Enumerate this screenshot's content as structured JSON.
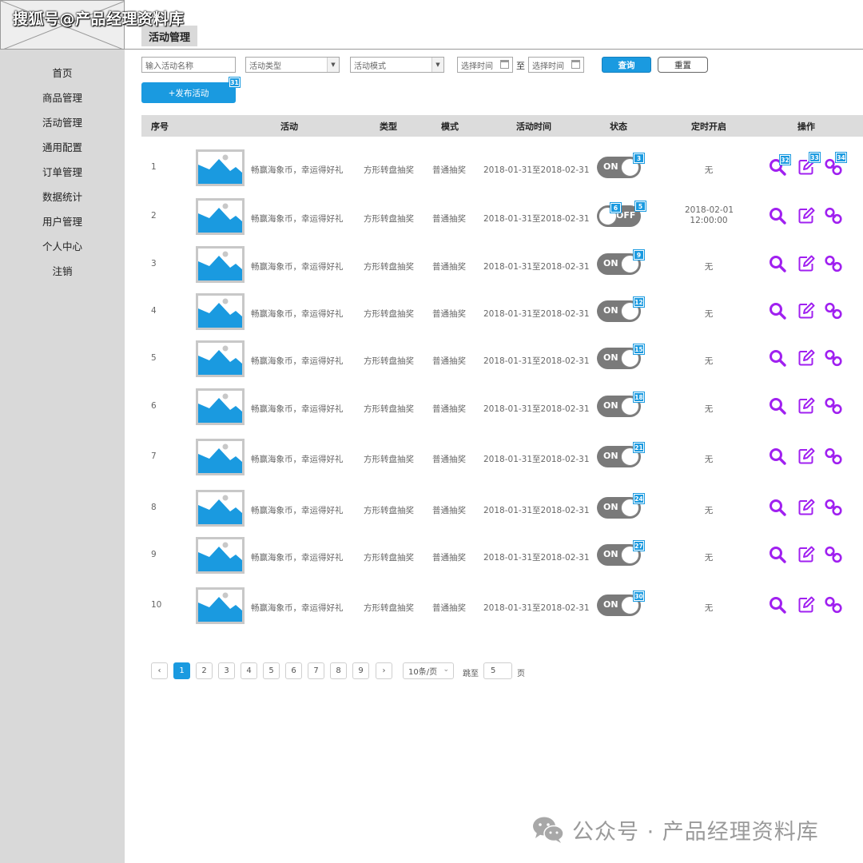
{
  "watermark_top": "搜狐号@产品经理资料库",
  "page_tab": "活动管理",
  "sidebar": {
    "items": [
      {
        "label": "首页"
      },
      {
        "label": "商品管理"
      },
      {
        "label": "活动管理"
      },
      {
        "label": "通用配置"
      },
      {
        "label": "订单管理"
      },
      {
        "label": "数据统计"
      },
      {
        "label": "用户管理"
      },
      {
        "label": "个人中心"
      },
      {
        "label": "注销"
      }
    ]
  },
  "filters": {
    "name_placeholder": "输入活动名称",
    "type_placeholder": "活动类型",
    "mode_placeholder": "活动模式",
    "start_placeholder": "选择时间",
    "to_label": "至",
    "end_placeholder": "选择时间",
    "query_label": "查询",
    "reset_label": "重置"
  },
  "publish": {
    "label": "+发布活动",
    "badge": "31"
  },
  "table": {
    "headers": [
      "序号",
      "活动",
      "类型",
      "模式",
      "活动时间",
      "状态",
      "定时开启",
      "操作"
    ],
    "op_badges": [
      "32",
      "33",
      "34"
    ],
    "rows": [
      {
        "idx": "1",
        "name": "畅赢海象币，幸运得好礼",
        "type": "方形转盘抽奖",
        "mode": "普通抽奖",
        "time": "2018-01-31至2018-02-31",
        "status": "ON",
        "badges": [
          "3"
        ],
        "timer": [
          "无"
        ]
      },
      {
        "idx": "2",
        "name": "畅赢海象币，幸运得好礼",
        "type": "方形转盘抽奖",
        "mode": "普通抽奖",
        "time": "2018-01-31至2018-02-31",
        "status": "OFF",
        "badges": [
          "6",
          "5"
        ],
        "timer": [
          "2018-02-01",
          "12:00:00"
        ]
      },
      {
        "idx": "3",
        "name": "畅赢海象币，幸运得好礼",
        "type": "方形转盘抽奖",
        "mode": "普通抽奖",
        "time": "2018-01-31至2018-02-31",
        "status": "ON",
        "badges": [
          "9"
        ],
        "timer": [
          "无"
        ]
      },
      {
        "idx": "4",
        "name": "畅赢海象币，幸运得好礼",
        "type": "方形转盘抽奖",
        "mode": "普通抽奖",
        "time": "2018-01-31至2018-02-31",
        "status": "ON",
        "badges": [
          "12"
        ],
        "timer": [
          "无"
        ]
      },
      {
        "idx": "5",
        "name": "畅赢海象币，幸运得好礼",
        "type": "方形转盘抽奖",
        "mode": "普通抽奖",
        "time": "2018-01-31至2018-02-31",
        "status": "ON",
        "badges": [
          "15"
        ],
        "timer": [
          "无"
        ]
      },
      {
        "idx": "6",
        "name": "畅赢海象币，幸运得好礼",
        "type": "方形转盘抽奖",
        "mode": "普通抽奖",
        "time": "2018-01-31至2018-02-31",
        "status": "ON",
        "badges": [
          "18"
        ],
        "timer": [
          "无"
        ]
      },
      {
        "idx": "7",
        "name": "畅赢海象币，幸运得好礼",
        "type": "方形转盘抽奖",
        "mode": "普通抽奖",
        "time": "2018-01-31至2018-02-31",
        "status": "ON",
        "badges": [
          "21"
        ],
        "timer": [
          "无"
        ]
      },
      {
        "idx": "8",
        "name": "畅赢海象币，幸运得好礼",
        "type": "方形转盘抽奖",
        "mode": "普通抽奖",
        "time": "2018-01-31至2018-02-31",
        "status": "ON",
        "badges": [
          "24"
        ],
        "timer": [
          "无"
        ]
      },
      {
        "idx": "9",
        "name": "畅赢海象币，幸运得好礼",
        "type": "方形转盘抽奖",
        "mode": "普通抽奖",
        "time": "2018-01-31至2018-02-31",
        "status": "ON",
        "badges": [
          "27"
        ],
        "timer": [
          "无"
        ]
      },
      {
        "idx": "10",
        "name": "畅赢海象币，幸运得好礼",
        "type": "方形转盘抽奖",
        "mode": "普通抽奖",
        "time": "2018-01-31至2018-02-31",
        "status": "ON",
        "badges": [
          "30"
        ],
        "timer": [
          "无"
        ]
      }
    ]
  },
  "pagination": {
    "pages": [
      "1",
      "2",
      "3",
      "4",
      "5",
      "6",
      "7",
      "8",
      "9"
    ],
    "active": "1",
    "prev": "‹",
    "next": "›",
    "page_size": "10条/页",
    "jump_label": "跳至",
    "jump_value": "5",
    "page_suffix": "页"
  },
  "watermark_bottom": "公众号 · 产品经理资料库",
  "colors": {
    "accent": "#1a9ae0",
    "op_icon": "#a020f0",
    "sidebar_bg": "#d9d9d9",
    "header_bg": "#dcdcdc"
  },
  "icons": {
    "view": "search-icon",
    "edit": "edit-icon",
    "link": "link-icon"
  }
}
